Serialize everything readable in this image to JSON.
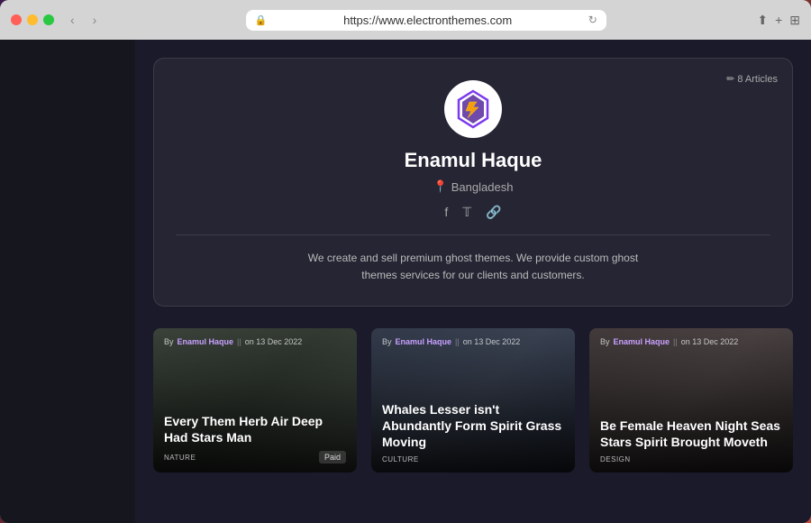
{
  "browser": {
    "url": "https://www.electronthemes.com",
    "back_label": "‹",
    "forward_label": "›",
    "share_label": "⬆",
    "add_tab_label": "+",
    "grid_label": "⊞"
  },
  "profile": {
    "articles_label": "✏ 8 Articles",
    "name": "Enamul Haque",
    "location": "Bangladesh",
    "location_icon": "📍",
    "bio": "We create and sell premium ghost themes. We provide custom ghost themes services for our clients and customers.",
    "social": {
      "facebook": "f",
      "twitter": "𝕏",
      "link": "🔗"
    }
  },
  "articles": [
    {
      "author": "Enamul Haque",
      "date": "on 13 Dec 2022",
      "title": "Every Them Herb Air Deep Had Stars Man",
      "tag": "NATURE",
      "badge": "Paid"
    },
    {
      "author": "Enamul Haque",
      "date": "on 13 Dec 2022",
      "title": "Whales Lesser isn't Abundantly Form Spirit Grass Moving",
      "tag": "CULTURE",
      "badge": ""
    },
    {
      "author": "Enamul Haque",
      "date": "on 13 Dec 2022",
      "title": "Be Female Heaven Night Seas Stars Spirit Brought Moveth",
      "tag": "DESIGN",
      "badge": ""
    }
  ]
}
